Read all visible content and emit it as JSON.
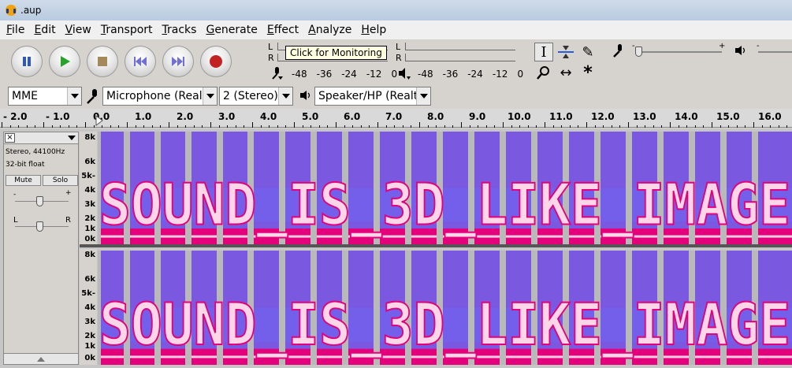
{
  "window": {
    "title": ".aup"
  },
  "menu": [
    "File",
    "Edit",
    "View",
    "Transport",
    "Tracks",
    "Generate",
    "Effect",
    "Analyze",
    "Help"
  ],
  "transport": {
    "buttons": [
      {
        "name": "pause-button",
        "icon": "pause-icon",
        "color": "#2f56c9"
      },
      {
        "name": "play-button",
        "icon": "play-icon",
        "color": "#27a327"
      },
      {
        "name": "stop-button",
        "icon": "stop-icon",
        "color": "#a48a5a"
      },
      {
        "name": "skip-start-button",
        "icon": "skip-start-icon",
        "color": "#6f6fd6"
      },
      {
        "name": "skip-end-button",
        "icon": "skip-end-icon",
        "color": "#6f6fd6"
      },
      {
        "name": "record-button",
        "icon": "record-icon",
        "color": "#c22222"
      }
    ]
  },
  "meters": {
    "record": {
      "l": "L",
      "r": "R",
      "scale": [
        "-48",
        "-36",
        "-24",
        "-12",
        "0"
      ]
    },
    "playback": {
      "l": "L",
      "r": "R",
      "scale": [
        "-48",
        "-36",
        "-24",
        "-12",
        "0"
      ]
    },
    "tooltip": "Click for Monitoring"
  },
  "mixer": {
    "minus": "-",
    "plus": "+"
  },
  "devices": {
    "host": "MME",
    "input": "Microphone (Real",
    "channels": "2 (Stereo)",
    "output": "Speaker/HP (Realt"
  },
  "ruler": {
    "labels": [
      "- 2.0",
      "- 1.0",
      "0.0",
      "1.0",
      "2.0",
      "3.0",
      "4.0",
      "5.0",
      "6.0",
      "7.0",
      "8.0",
      "9.0",
      "10.0",
      "11.0",
      "12.0",
      "13.0",
      "14.0",
      "15.0",
      "16.0"
    ]
  },
  "track": {
    "info1": "Stereo, 44100Hz",
    "info2": "32-bit float",
    "mute": "Mute",
    "solo": "Solo",
    "gain_minus": "-",
    "gain_plus": "+",
    "pan_left": "L",
    "pan_right": "R",
    "scale": [
      "8k",
      "6k",
      "5k-",
      "4k",
      "3k",
      "2k",
      "1k",
      "0k"
    ],
    "spectrogram_text": "SOUND_IS_3D_LIKE_IMAGE"
  },
  "colors": {
    "spectro_bg": "#7a58e0",
    "spectro_low": "#e3007a",
    "letter": "#ffd6e8",
    "gap": "#b9b9b9"
  }
}
